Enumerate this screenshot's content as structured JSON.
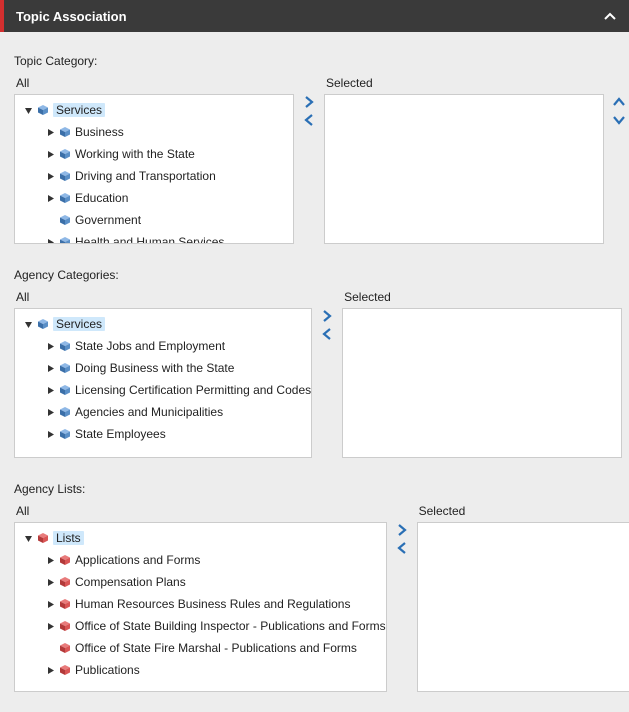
{
  "header": {
    "title": "Topic Association"
  },
  "sections": {
    "topic": {
      "label": "Topic Category:",
      "all_label": "All",
      "selected_label": "Selected",
      "root": {
        "label": "Services",
        "highlighted": true,
        "expandable": true,
        "expanded": true,
        "icon": "blue"
      },
      "children": [
        {
          "label": "Business",
          "expandable": true,
          "icon": "blue"
        },
        {
          "label": "Working with the State",
          "expandable": true,
          "icon": "blue"
        },
        {
          "label": "Driving and Transportation",
          "expandable": true,
          "icon": "blue"
        },
        {
          "label": "Education",
          "expandable": true,
          "icon": "blue"
        },
        {
          "label": "Government",
          "expandable": false,
          "icon": "blue"
        },
        {
          "label": "Health and Human Services",
          "expandable": true,
          "icon": "blue"
        }
      ]
    },
    "agency_cat": {
      "label": "Agency Categories:",
      "all_label": "All",
      "selected_label": "Selected",
      "root": {
        "label": "Services",
        "highlighted": true,
        "expandable": true,
        "expanded": true,
        "icon": "blue"
      },
      "children": [
        {
          "label": "State Jobs and Employment",
          "expandable": true,
          "icon": "blue"
        },
        {
          "label": "Doing Business with the State",
          "expandable": true,
          "icon": "blue"
        },
        {
          "label": "Licensing Certification Permitting and Codes",
          "expandable": true,
          "icon": "blue"
        },
        {
          "label": "Agencies and Municipalities",
          "expandable": true,
          "icon": "blue"
        },
        {
          "label": "State Employees",
          "expandable": true,
          "icon": "blue"
        }
      ]
    },
    "agency_lists": {
      "label": "Agency Lists:",
      "all_label": "All",
      "selected_label": "Selected",
      "root": {
        "label": "Lists",
        "highlighted": true,
        "expandable": true,
        "expanded": true,
        "icon": "red"
      },
      "children": [
        {
          "label": "Applications and Forms",
          "expandable": true,
          "icon": "red"
        },
        {
          "label": "Compensation Plans",
          "expandable": true,
          "icon": "red"
        },
        {
          "label": "Human Resources Business Rules and Regulations",
          "expandable": true,
          "icon": "red"
        },
        {
          "label": "Office of State Building Inspector - Publications and Forms",
          "expandable": true,
          "icon": "red"
        },
        {
          "label": "Office of State Fire Marshal - Publications and Forms",
          "expandable": false,
          "icon": "red"
        },
        {
          "label": "Publications",
          "expandable": true,
          "icon": "red"
        }
      ]
    }
  }
}
